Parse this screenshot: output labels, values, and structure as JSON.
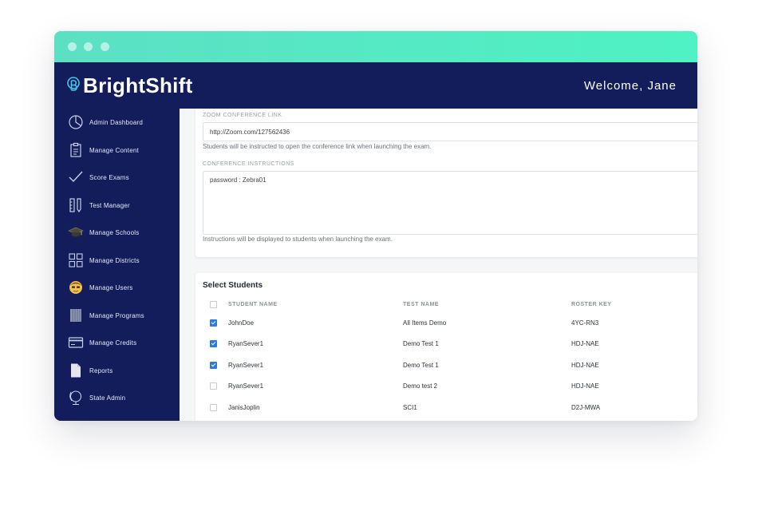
{
  "header": {
    "logo_text": "BrightShift",
    "welcome": "Welcome, Jane"
  },
  "sidebar": {
    "items": [
      {
        "label": "Admin Dashboard",
        "icon": "pie-chart-icon"
      },
      {
        "label": "Manage Content",
        "icon": "clipboard-icon"
      },
      {
        "label": "Score Exams",
        "icon": "checkmark-icon"
      },
      {
        "label": "Test Manager",
        "icon": "ruler-pencil-icon"
      },
      {
        "label": "Manage Schools",
        "icon": "graduation-cap-icon"
      },
      {
        "label": "Manage Districts",
        "icon": "grid-icon"
      },
      {
        "label": "Manage Users",
        "icon": "user-face-icon"
      },
      {
        "label": "Manage Programs",
        "icon": "book-icon"
      },
      {
        "label": "Manage Credits",
        "icon": "credit-card-icon"
      },
      {
        "label": "Reports",
        "icon": "document-icon"
      },
      {
        "label": "State Admin",
        "icon": "globe-icon"
      }
    ]
  },
  "conference": {
    "link_label": "ZOOM CONFERENCE LINK",
    "link_value": "http://Zoom.com/127562436",
    "link_help": "Students will be instructed to open the conference link when launching the exam.",
    "instructions_label": "CONFERENCE INSTRUCTIONS",
    "instructions_value": "password : Zebra01",
    "instructions_help": "Instructions will be displayed to students when launching the exam."
  },
  "students": {
    "title": "Select Students",
    "columns": [
      "STUDENT NAME",
      "TEST NAME",
      "ROSTER KEY"
    ],
    "rows": [
      {
        "name": "JohnDoe",
        "test": "All Items Demo",
        "key": "4YC-RN3",
        "checked": true
      },
      {
        "name": "RyanSever1",
        "test": "Demo Test 1",
        "key": "HDJ-NAE",
        "checked": true
      },
      {
        "name": "RyanSever1",
        "test": "Demo Test 1",
        "key": "HDJ-NAE",
        "checked": true
      },
      {
        "name": "RyanSever1",
        "test": "Demo test 2",
        "key": "HDJ-NAE",
        "checked": false
      },
      {
        "name": "JanisJoplin",
        "test": "SCI1",
        "key": "D2J-MWA",
        "checked": false
      }
    ]
  },
  "colors": {
    "navy": "#131d5c",
    "teal": "#4ef2c3",
    "accent_blue": "#2d7be0"
  }
}
